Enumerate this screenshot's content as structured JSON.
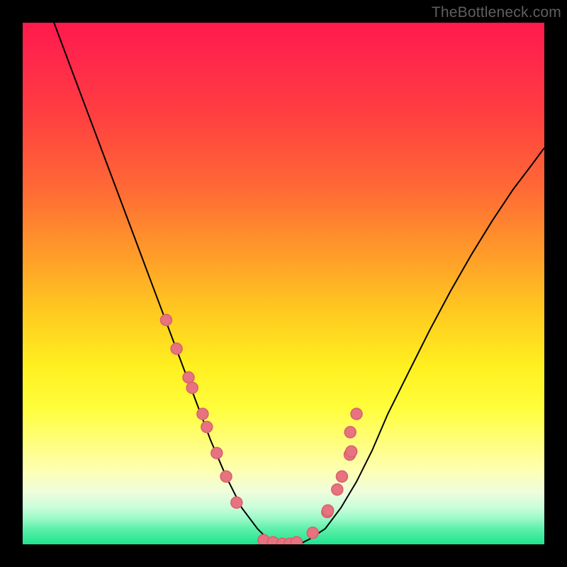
{
  "watermark": "TheBottleneck.com",
  "chart_data": {
    "type": "line",
    "title": "",
    "xlabel": "",
    "ylabel": "",
    "xlim": [
      0,
      1
    ],
    "ylim": [
      0,
      1
    ],
    "series": [
      {
        "name": "curve",
        "x": [
          0.06,
          0.09,
          0.12,
          0.15,
          0.18,
          0.21,
          0.24,
          0.27,
          0.3,
          0.33,
          0.36,
          0.39,
          0.42,
          0.45,
          0.47,
          0.49,
          0.51,
          0.53,
          0.55,
          0.58,
          0.61,
          0.64,
          0.67,
          0.7,
          0.74,
          0.78,
          0.82,
          0.86,
          0.9,
          0.94,
          0.98,
          1.0
        ],
        "y": [
          1.0,
          0.92,
          0.84,
          0.76,
          0.68,
          0.6,
          0.52,
          0.44,
          0.36,
          0.28,
          0.2,
          0.13,
          0.07,
          0.03,
          0.01,
          0.0,
          0.0,
          0.0,
          0.01,
          0.03,
          0.07,
          0.12,
          0.18,
          0.25,
          0.33,
          0.41,
          0.485,
          0.555,
          0.62,
          0.68,
          0.733,
          0.76
        ]
      }
    ],
    "markers": {
      "name": "points",
      "x": [
        0.275,
        0.295,
        0.318,
        0.325,
        0.345,
        0.353,
        0.372,
        0.39,
        0.41,
        0.462,
        0.48,
        0.498,
        0.512,
        0.525,
        0.556,
        0.584,
        0.585,
        0.603,
        0.612,
        0.627,
        0.63,
        0.628,
        0.64
      ],
      "y": [
        0.43,
        0.375,
        0.32,
        0.3,
        0.25,
        0.225,
        0.175,
        0.13,
        0.08,
        0.008,
        0.004,
        0.001,
        0.001,
        0.004,
        0.022,
        0.062,
        0.065,
        0.105,
        0.13,
        0.172,
        0.178,
        0.215,
        0.25
      ]
    },
    "marker_style": {
      "r": 8,
      "fill": "#e6737f",
      "stroke": "#d95f6d"
    },
    "curve_style": {
      "stroke": "#000000",
      "width": 2
    }
  }
}
